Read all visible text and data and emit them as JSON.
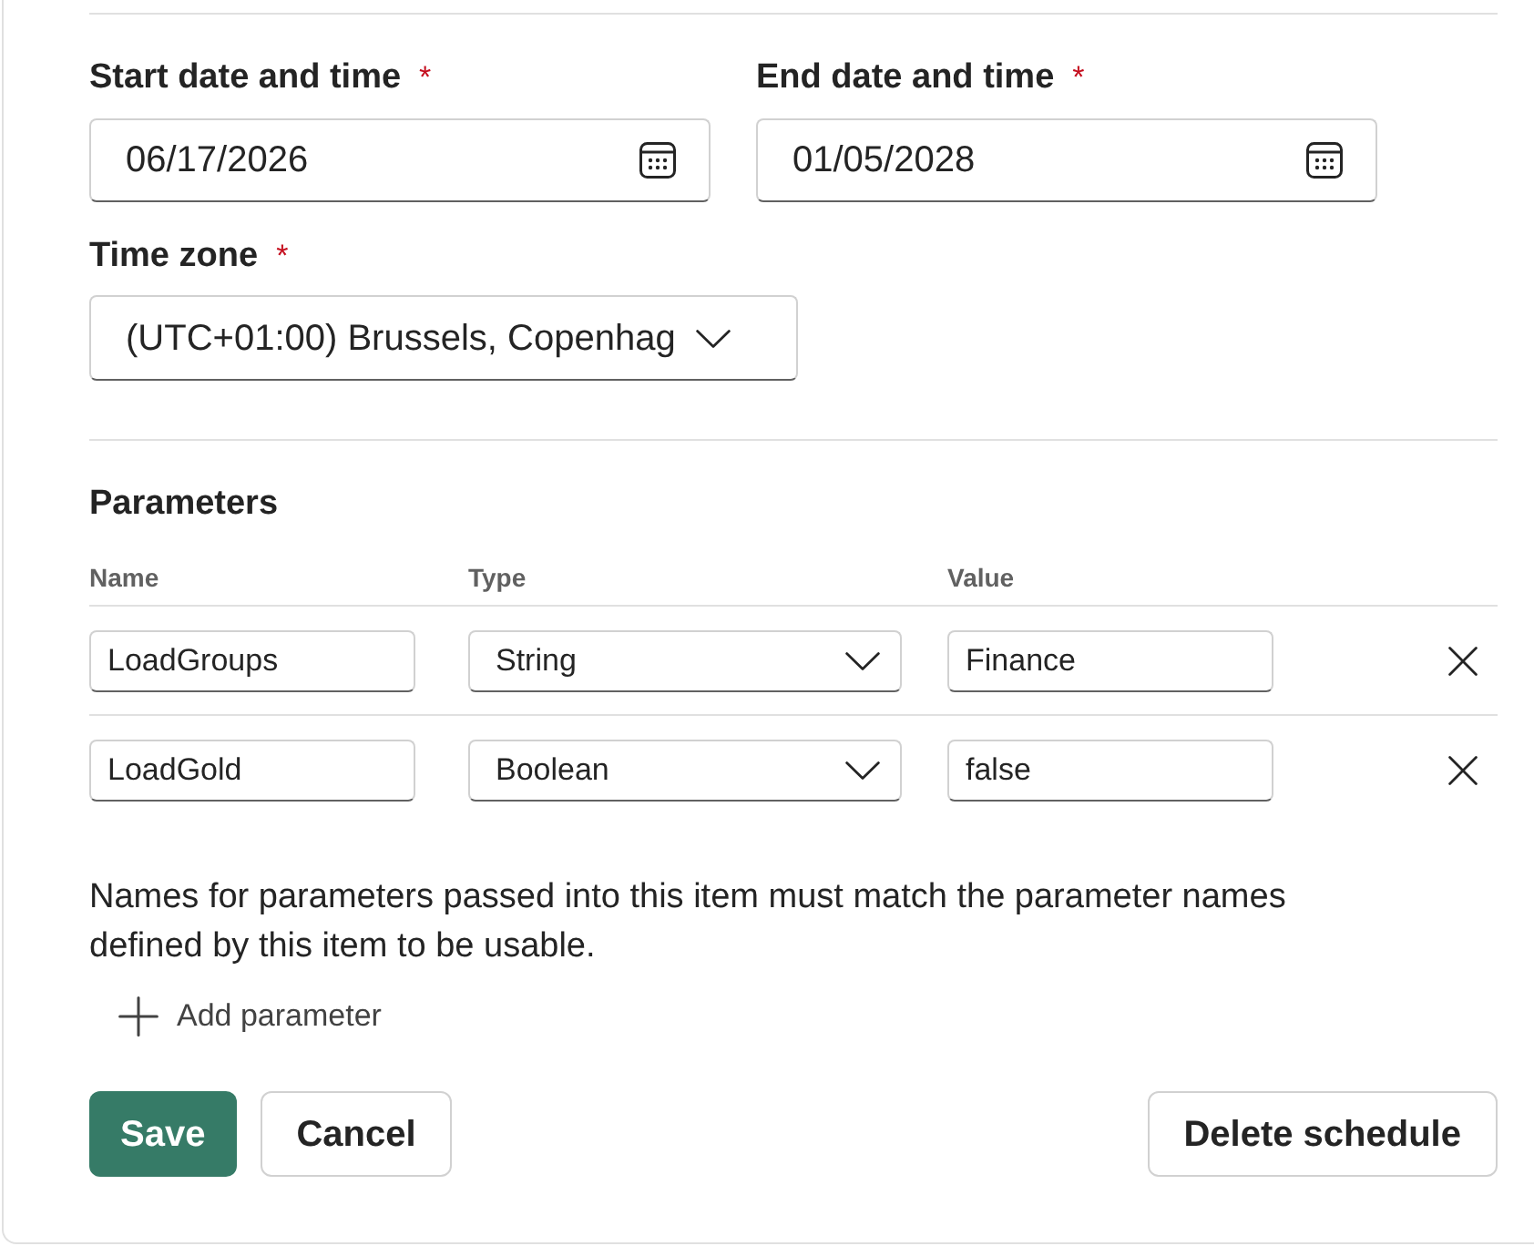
{
  "date_fields": [
    {
      "label": "Start date and time",
      "required_mark": "*",
      "value": "06/17/2026"
    },
    {
      "label": "End date and time",
      "required_mark": "*",
      "value": "01/05/2028"
    }
  ],
  "time_zone": {
    "label": "Time zone",
    "required_mark": "*",
    "value": "(UTC+01:00) Brussels, Copenhag"
  },
  "parameters": {
    "title": "Parameters",
    "columns": [
      "Name",
      "Type",
      "Value"
    ],
    "rows": [
      {
        "name": "LoadGroups",
        "type": "String",
        "value": "Finance"
      },
      {
        "name": "LoadGold",
        "type": "Boolean",
        "value": "false"
      }
    ],
    "note": "Names for parameters passed into this item must match the parameter names defined by this item to be usable.",
    "add_label": "Add parameter"
  },
  "buttons": [
    {
      "label": "Save",
      "kind": "primary"
    },
    {
      "label": "Cancel",
      "kind": "secondary"
    },
    {
      "label": "Delete schedule",
      "kind": "secondary"
    }
  ]
}
